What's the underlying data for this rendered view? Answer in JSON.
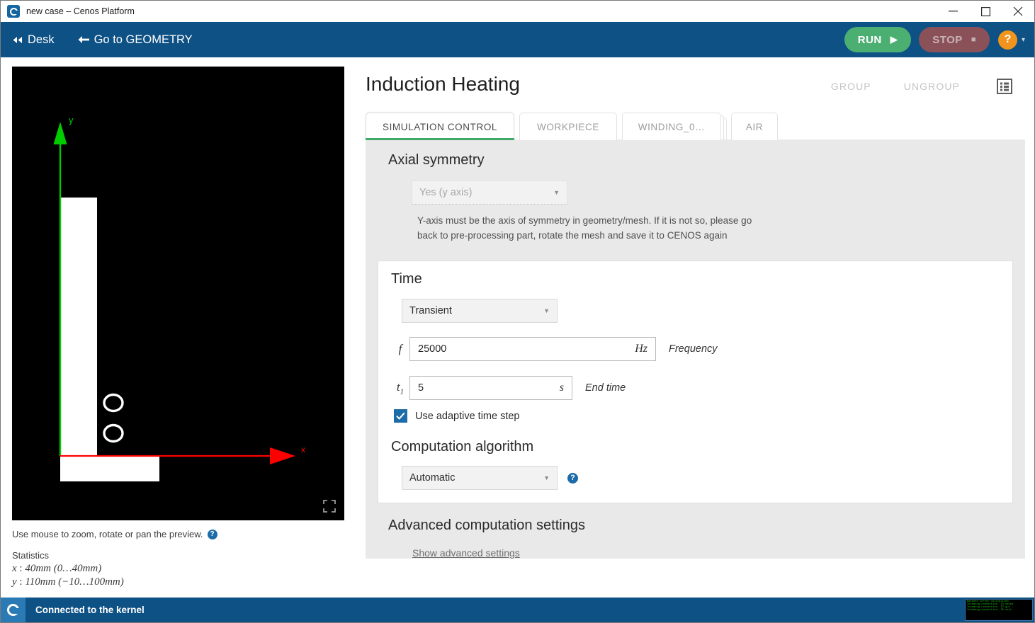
{
  "window": {
    "title": "new case – Cenos Platform",
    "app_icon": "cenos-logo-icon",
    "minimize": "minimize-icon",
    "maximize": "maximize-icon",
    "close": "close-icon"
  },
  "toolbar": {
    "desk_label": "Desk",
    "geometry_label": "Go to GEOMETRY",
    "run_label": "RUN",
    "stop_label": "STOP",
    "help_label": "?",
    "caret": "▾",
    "run_color": "#4caf72",
    "stop_color": "#8a5258",
    "bar_color": "#0e5185",
    "help_color": "#f0941e"
  },
  "preview": {
    "hint": "Use mouse to zoom, rotate or pan the preview.",
    "help_label": "?",
    "fullscreen_icon": "fullscreen-icon",
    "axis_y_label": "y",
    "axis_x_label": "x",
    "axis_y_color": "#00cc00",
    "axis_x_color": "#ff0000",
    "background": "#000000",
    "statistics_title": "Statistics",
    "stat_x_sym": "x",
    "stat_x_val": "40mm (0…40mm)",
    "stat_y_sym": "y",
    "stat_y_val": "110mm (−10…100mm)"
  },
  "header": {
    "title": "Induction Heating",
    "group_label": "GROUP",
    "ungroup_label": "UNGROUP",
    "list_icon": "list-view-icon"
  },
  "tabs": [
    {
      "label": "SIMULATION CONTROL",
      "active": true
    },
    {
      "label": "WORKPIECE",
      "active": false
    },
    {
      "label": "WINDING_0…",
      "active": false
    },
    {
      "label": "AIR",
      "active": false
    }
  ],
  "axial": {
    "title": "Axial symmetry",
    "select_value": "Yes (y axis)",
    "select_arrow": "▼",
    "hint_line1": "Y-axis must be the axis of symmetry in geometry/mesh. If it is not so, please go",
    "hint_line2": "back to pre-processing part, rotate the mesh and save it to CENOS again"
  },
  "time": {
    "title": "Time",
    "mode_value": "Transient",
    "mode_arrow": "▼",
    "frequency_symbol": "f",
    "frequency_value": "25000",
    "frequency_unit": "Hz",
    "frequency_label": "Frequency",
    "endtime_symbol": "t",
    "endtime_symbol_sub": "1",
    "endtime_value": "5",
    "endtime_unit": "s",
    "endtime_label": "End time",
    "adaptive_label": "Use adaptive time step",
    "adaptive_checked": true
  },
  "algorithm": {
    "title": "Computation algorithm",
    "select_value": "Automatic",
    "select_arrow": "▼",
    "help_label": "?"
  },
  "advanced": {
    "title": "Advanced computation settings",
    "link_label": "Show advanced settings"
  },
  "status": {
    "text": "Connected to the kernel",
    "icon": "cenos-logo-icon",
    "console_lines": [
      "Backend server initialized.",
      "Incoming connection. ID backe",
      "Incoming connection. ID gui :",
      "Incoming connection. ID salo"
    ]
  }
}
